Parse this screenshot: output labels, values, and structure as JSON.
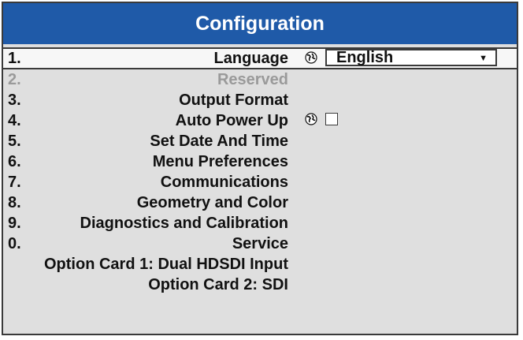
{
  "title": "Configuration",
  "items": [
    {
      "num": "1.",
      "label": "Language"
    },
    {
      "num": "2.",
      "label": "Reserved"
    },
    {
      "num": "3.",
      "label": "Output Format"
    },
    {
      "num": "4.",
      "label": "Auto Power Up"
    },
    {
      "num": "5.",
      "label": "Set Date And Time"
    },
    {
      "num": "6.",
      "label": "Menu Preferences"
    },
    {
      "num": "7.",
      "label": "Communications"
    },
    {
      "num": "8.",
      "label": "Geometry and Color"
    },
    {
      "num": "9.",
      "label": "Diagnostics and Calibration"
    },
    {
      "num": "0.",
      "label": "Service"
    },
    {
      "num": "",
      "label": "Option Card 1: Dual HDSDI Input"
    },
    {
      "num": "",
      "label": "Option Card 2: SDI"
    }
  ],
  "language_dropdown": {
    "value": "English",
    "icon": "chevron-down-icon"
  },
  "auto_power_up": {
    "checked": false,
    "icon": "globe-icon"
  },
  "colors": {
    "title_bar": "#1f5aa8",
    "panel": "#dfdfdf",
    "disabled_text": "#9a9a9a"
  }
}
